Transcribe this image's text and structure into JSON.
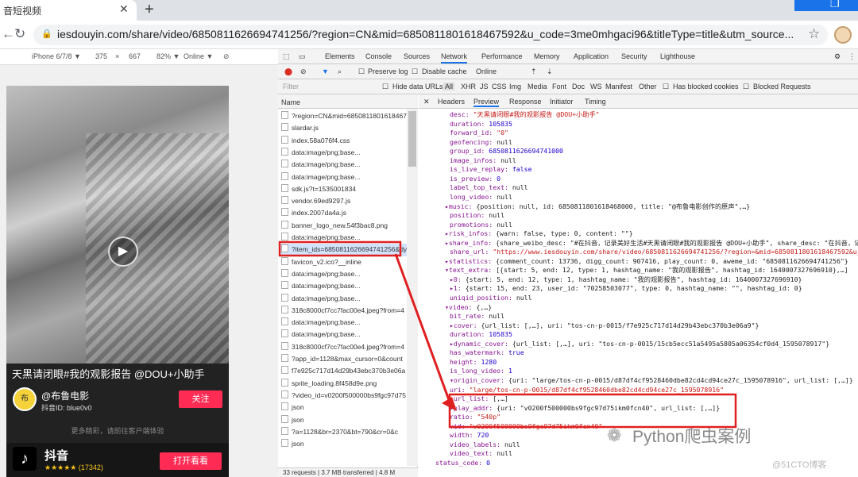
{
  "browser": {
    "tab_title": "音短视频",
    "url": "iesdouyin.com/share/video/6850811626694741256/?region=CN&mid=6850811801618467592&u_code=3me0mhgaci96&titleType=title&utm_source..."
  },
  "device_bar": {
    "device": "iPhone 6/7/8 ▼",
    "width": "375",
    "height": "667",
    "zoom": "82% ▼",
    "network": "Online ▼"
  },
  "phone": {
    "description": "天黑请闭眼#我的观影报告 @DOU+小助手",
    "author": "@布鲁电影",
    "author_id": "抖音ID: blue0v0",
    "follow": "关注",
    "more_tip": "更多精彩，请前往客户端体验",
    "app_name": "抖音",
    "app_rating": "★★★★★ (17342)",
    "open_app": "打开看看",
    "avatar_text": "布"
  },
  "devtools": {
    "tabs": [
      "Elements",
      "Console",
      "Sources",
      "Network",
      "Performance",
      "Memory",
      "Application",
      "Security",
      "Lighthouse"
    ],
    "net": {
      "preserve_log": "Preserve log",
      "disable_cache": "Disable cache",
      "online": "Online"
    },
    "filter": {
      "placeholder": "Filter",
      "hide_data": "Hide data URLs",
      "all": "All",
      "types": [
        "XHR",
        "JS",
        "CSS",
        "Img",
        "Media",
        "Font",
        "Doc",
        "WS",
        "Manifest",
        "Other"
      ],
      "blocked_cookies": "Has blocked cookies",
      "blocked_requests": "Blocked Requests"
    },
    "name_header": "Name",
    "requests": [
      "?region=CN&mid=6850811801618467592",
      "slardar.js",
      "index.58a076f4.css",
      "data:image/png;base...",
      "data:image/png;base...",
      "data:image/png;base...",
      "sdk.js?t=1535001834",
      "vendor.69ed9297.js",
      "index.2007da4a.js",
      "banner_logo_new.54f3bac8.png",
      "data:image/png;base...",
      "?item_ids=6850811626694741256&dytk",
      "favicon_v2.ico?__inline",
      "data:image/png;base...",
      "data:image/png;base...",
      "data:image/png;base...",
      "318c8000cf7cc7fac00e4.jpeg?from=4",
      "data:image/png;base...",
      "data:image/png;base...",
      "318c8000cf7cc7fac00e4.jpeg?from=4",
      "?app_id=1128&max_cursor=0&count",
      "f7e925c717d14d29b43ebc370b3e06a",
      "sprite_loading.8f458d9e.png",
      "?video_id=v0200f500000bs9fgc97d75",
      "json",
      "json",
      "?a=1128&br=2370&bt=790&cr=0&c",
      "json"
    ],
    "status": "33 requests  |  3.7 MB transferred  |  4.8 M",
    "detail_tabs": [
      "Headers",
      "Preview",
      "Response",
      "Initiator",
      "Timing"
    ],
    "preview_lines": [
      [
        "desc: ",
        "\"天黑请闭眼#我的观影报告  @DOU+小助手\"",
        "s",
        0
      ],
      [
        "duration: ",
        "105835",
        "n",
        0
      ],
      [
        "forward_id: ",
        "\"0\"",
        "s",
        0
      ],
      [
        "geofencing: ",
        "null",
        "o",
        0
      ],
      [
        "group_id: ",
        "6850811626694741000",
        "n",
        0
      ],
      [
        "image_infos: ",
        "null",
        "o",
        0
      ],
      [
        "is_live_replay: ",
        "false",
        "n",
        0
      ],
      [
        "is_preview: ",
        "0",
        "n",
        0
      ],
      [
        "label_top_text: ",
        "null",
        "o",
        0
      ],
      [
        "long_video: ",
        "null",
        "o",
        0
      ],
      [
        "▸music: ",
        "{position: null, id: 6850811801618468000, title: \"@布鲁电影创作的原声\",…}",
        "o",
        -1
      ],
      [
        "position: ",
        "null",
        "o",
        0
      ],
      [
        "promotions: ",
        "null",
        "o",
        0
      ],
      [
        "▸risk_infos: ",
        "{warn: false, type: 0, content: \"\"}",
        "o",
        -1
      ],
      [
        "▸share_info: ",
        "{share_weibo_desc: \"#在抖音，记录美好生活#天黑请闭眼#我的观影报告 @DOU+小助手\", share_desc: \"在抖音，记录美",
        "o",
        -1
      ],
      [
        "share_url: ",
        "\"https://www.iesdouyin.com/share/video/6850811626694741256/?region=&mid=6850811801618467592&u_code",
        "s",
        0
      ],
      [
        "▸statistics: ",
        "{comment_count: 13736, digg_count: 907416, play_count: 0, aweme_id: \"6850811626694741256\"}",
        "o",
        -1
      ],
      [
        "▾text_extra: ",
        "[{start: 5, end: 12, type: 1, hashtag_name: \"我的观影报告\", hashtag_id: 1640007327696910},…]",
        "o",
        -1
      ],
      [
        "  ▸0: ",
        "{start: 5, end: 12, type: 1, hashtag_name: \"我的观影报告\", hashtag_id: 1640007327696910}",
        "o",
        0
      ],
      [
        "  ▸1: ",
        "{start: 15, end: 23, user_id: \"70258503077\", type: 0, hashtag_name: \"\", hashtag_id: 0}",
        "o",
        0
      ],
      [
        "uniqid_position: ",
        "null",
        "o",
        0
      ],
      [
        "▾video: ",
        "{,…}",
        "o",
        -1
      ],
      [
        "  bit_rate: ",
        "null",
        "o",
        1
      ],
      [
        "  ▸cover: ",
        "{url_list: [,…], uri: \"tos-cn-p-0015/f7e925c717d14d29b43ebc370b3e06a9\"}",
        "o",
        1
      ],
      [
        "  duration: ",
        "105835",
        "n",
        1
      ],
      [
        "  ▸dynamic_cover: ",
        "{url_list: [,…], uri: \"tos-cn-p-0015/15cb5ecc51a5495a5805a06354cf0d4_1595078917\"}",
        "o",
        1
      ],
      [
        "  has_watermark: ",
        "true",
        "n",
        1
      ],
      [
        "  height: ",
        "1280",
        "n",
        1
      ],
      [
        "  is_long_video: ",
        "1",
        "n",
        1
      ],
      [
        "  ▾origin_cover: ",
        "{uri: \"large/tos-cn-p-0015/d87df4cf9528460dbe82cd4cd94ce27c_1595078916\", url_list: [,…]}",
        "o",
        1
      ],
      [
        "     uri: ",
        "\"large/tos-cn-p-0015/d87df4cf9528460dbe82cd4cd94ce27c_1595078916\"",
        "s",
        1
      ],
      [
        "    ▸url_list: ",
        "[,…]",
        "o",
        1
      ],
      [
        "  ▸play_addr: ",
        "{uri: \"v0200f500000bs9fgc97d75ikm0fcn40\", url_list: [,…]}",
        "o",
        1
      ],
      [
        "  ratio: ",
        "\"540p\"",
        "s",
        1
      ],
      [
        "  vid: ",
        "\"v0200f500000bs9fgc97d75ikm0fcn40\"",
        "s",
        1
      ],
      [
        "  width: ",
        "720",
        "n",
        1
      ],
      [
        "video_labels: ",
        "null",
        "o",
        0
      ],
      [
        "video_text: ",
        "null",
        "o",
        0
      ],
      [
        "status_code: ",
        "0",
        "n",
        -2
      ]
    ]
  },
  "watermark": {
    "text": "Python爬虫案例",
    "site": "@51CTO博客"
  }
}
